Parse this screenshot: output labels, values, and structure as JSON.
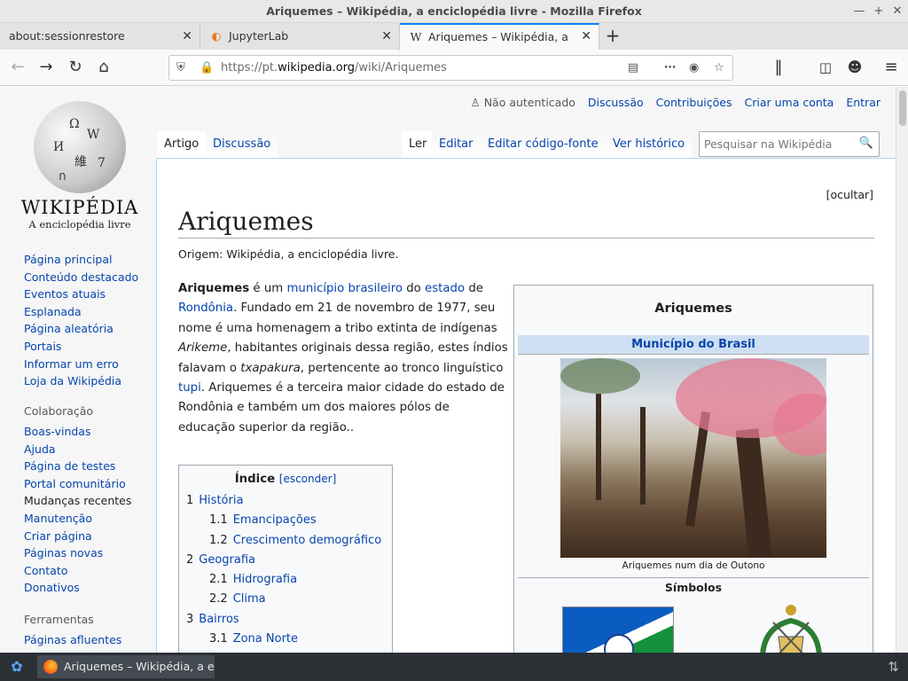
{
  "window": {
    "title": "Ariquemes – Wikipédia, a enciclopédia livre - Mozilla Firefox"
  },
  "tabs": [
    {
      "label": "about:sessionrestore"
    },
    {
      "label": "JupyterLab"
    },
    {
      "label": "Ariquemes – Wikipédia, a enc"
    }
  ],
  "url": {
    "prefix": "https://pt.",
    "domain": "wikipedia.org",
    "path": "/wiki/Ariquemes"
  },
  "logo": {
    "wordmark": "WIKIPÉDIA",
    "tagline": "A enciclopédia livre"
  },
  "sidebar": {
    "main": [
      "Página principal",
      "Conteúdo destacado",
      "Eventos atuais",
      "Esplanada",
      "Página aleatória",
      "Portais",
      "Informar um erro",
      "Loja da Wikipédia"
    ],
    "collab_head": "Colaboração",
    "collab": [
      "Boas-vindas",
      "Ajuda",
      "Página de testes",
      "Portal comunitário",
      "Mudanças recentes",
      "Manutenção",
      "Criar página",
      "Páginas novas",
      "Contato",
      "Donativos"
    ],
    "tools_head": "Ferramentas",
    "tools": [
      "Páginas afluentes"
    ]
  },
  "personal": {
    "status": "Não autenticado",
    "talk": "Discussão",
    "contribs": "Contribuições",
    "create": "Criar uma conta",
    "login": "Entrar"
  },
  "page_tabs": {
    "article": "Artigo",
    "talk": "Discussão",
    "read": "Ler",
    "edit": "Editar",
    "edit_source": "Editar código-fonte",
    "history": "Ver histórico"
  },
  "search": {
    "placeholder": "Pesquisar na Wikipédia"
  },
  "article": {
    "hide": "[ocultar]",
    "title": "Ariquemes",
    "origin": "Origem: Wikipédia, a enciclopédia livre.",
    "lede": {
      "w1": "Ariquemes",
      "t1": " é um ",
      "l1": "município brasileiro",
      "t2": " do ",
      "l2": "estado",
      "t3": " de ",
      "l3": "Rondônia",
      "t4": ". Fundado em 21 de novembro de 1977, seu nome é uma homenagem a tribo extinta de indígenas ",
      "i1": "Arikeme",
      "t5": ", habitantes originais dessa região, estes índios falavam o ",
      "i2": "txapakura",
      "t6": ", pertencente ao tronco linguístico ",
      "l4": "tupi",
      "t7": ". Ariquemes é a terceira maior cidade do estado de Rondônia e também um dos maiores pólos de educação superior da região.."
    }
  },
  "toc": {
    "title": "Índice",
    "toggle": "esconder",
    "items": [
      {
        "n": "1",
        "label": "História"
      },
      {
        "n": "1.1",
        "label": "Emancipações"
      },
      {
        "n": "1.2",
        "label": "Crescimento demográfico"
      },
      {
        "n": "2",
        "label": "Geografia"
      },
      {
        "n": "2.1",
        "label": "Hidrografia"
      },
      {
        "n": "2.2",
        "label": "Clima"
      },
      {
        "n": "3",
        "label": "Bairros"
      },
      {
        "n": "3.1",
        "label": "Zona Norte"
      }
    ]
  },
  "infobox": {
    "title": "Ariquemes",
    "subtitle": "Município do Brasil",
    "caption": "Ariquemes num dia de Outono",
    "symbols": "Símbolos"
  },
  "taskbar": {
    "item": "Ariquemes – Wikipédia, a en..."
  },
  "colors": {
    "link": "#0645ad",
    "tab_accent": "#0a84ff",
    "infobox_header": "#cedff2",
    "taskbar": "#2b3035"
  }
}
